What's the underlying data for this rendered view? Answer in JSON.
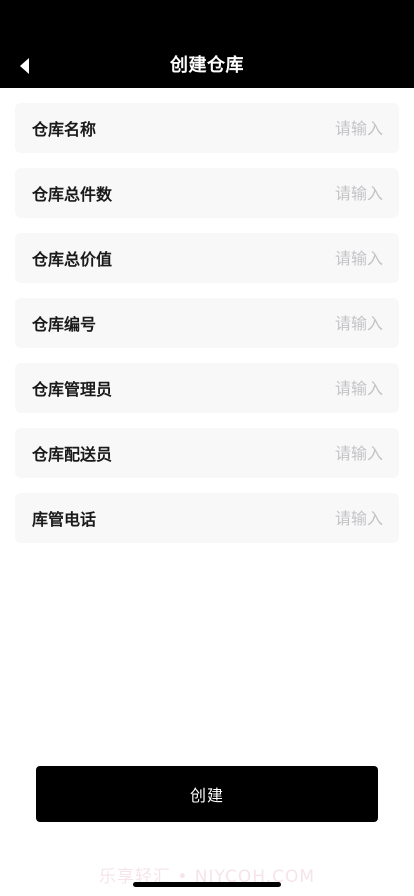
{
  "header": {
    "title": "创建仓库",
    "back_icon": "chevron-left-icon"
  },
  "form": {
    "fields": [
      {
        "label": "仓库名称",
        "placeholder": "请输入",
        "value": ""
      },
      {
        "label": "仓库总件数",
        "placeholder": "请输入",
        "value": ""
      },
      {
        "label": "仓库总价值",
        "placeholder": "请输入",
        "value": ""
      },
      {
        "label": "仓库编号",
        "placeholder": "请输入",
        "value": ""
      },
      {
        "label": "仓库管理员",
        "placeholder": "请输入",
        "value": ""
      },
      {
        "label": "仓库配送员",
        "placeholder": "请输入",
        "value": ""
      },
      {
        "label": "库管电话",
        "placeholder": "请输入",
        "value": ""
      }
    ]
  },
  "footer": {
    "create_label": "创建",
    "watermark": "乐享轻汇 • NJYCQH.COM"
  },
  "colors": {
    "header_bg": "#000000",
    "field_bg": "#f8f8f9",
    "placeholder": "#c3c3c6",
    "button_bg": "#000000"
  }
}
